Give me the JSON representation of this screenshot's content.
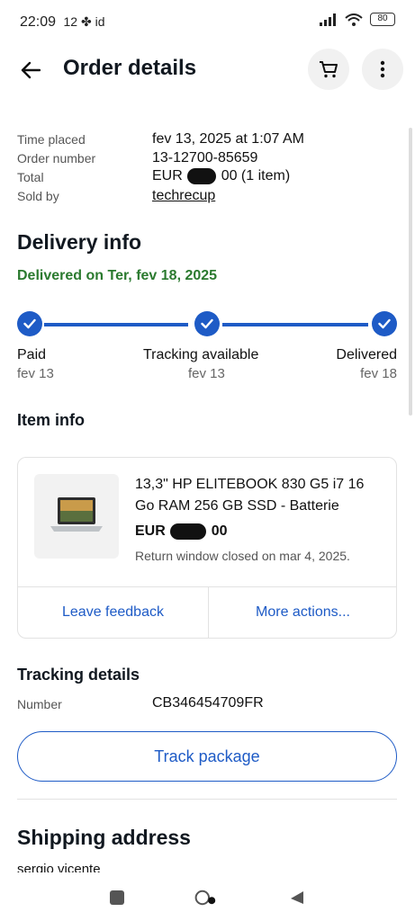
{
  "status_bar": {
    "time": "22:09",
    "extra": "12 ✤ id",
    "battery": "80"
  },
  "header": {
    "title": "Order details"
  },
  "summary": [
    {
      "label": "Time placed",
      "value": "fev 13, 2025 at 1:07 AM"
    },
    {
      "label": "Order number",
      "value": "13-12700-85659"
    },
    {
      "label": "Total",
      "value_prefix": "EUR",
      "value_suffix": "00 (1 item)"
    },
    {
      "label": "Sold by",
      "value": "techrecup"
    }
  ],
  "delivery": {
    "heading": "Delivery info",
    "status": "Delivered on Ter, fev 18, 2025",
    "steps": [
      {
        "label": "Paid",
        "date": "fev 13"
      },
      {
        "label": "Tracking available",
        "date": "fev 13"
      },
      {
        "label": "Delivered",
        "date": "fev 18"
      }
    ]
  },
  "item": {
    "heading": "Item info",
    "title": "13,3\" HP ELITEBOOK 830 G5 i7 16 Go RAM 256 GB SSD - Batterie",
    "price_prefix": "EUR",
    "price_suffix": "00",
    "note": "Return window closed on mar 4, 2025.",
    "actions": {
      "feedback": "Leave feedback",
      "more": "More actions..."
    }
  },
  "tracking": {
    "heading": "Tracking details",
    "label": "Number",
    "number": "CB346454709FR",
    "button": "Track package"
  },
  "shipping": {
    "heading": "Shipping address",
    "name": "sergio vicente"
  },
  "colors": {
    "accent": "#1e5bc6",
    "delivered": "#2b7a2f"
  }
}
